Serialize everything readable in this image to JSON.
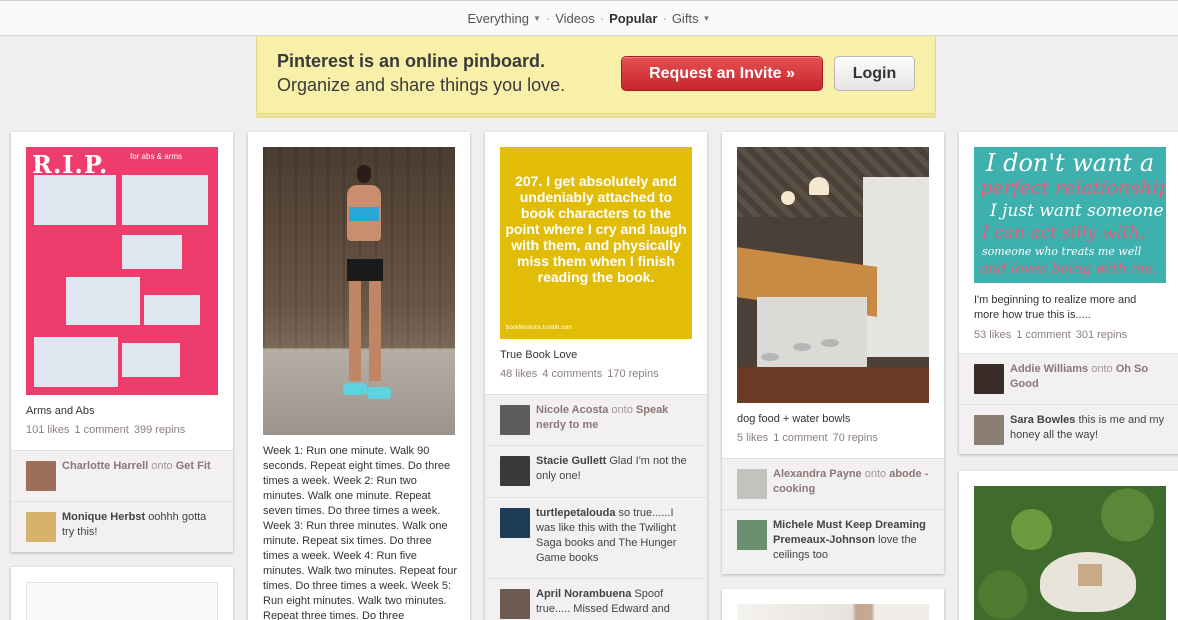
{
  "nav": {
    "everything": "Everything",
    "videos": "Videos",
    "popular": "Popular",
    "gifts": "Gifts",
    "separator": "·"
  },
  "banner": {
    "line1": "Pinterest is an online pinboard.",
    "line2": "Organize and share things you love.",
    "invite_label": "Request an Invite »",
    "login_label": "Login"
  },
  "pins": [
    {
      "title": "Arms and Abs",
      "likes": "101 likes",
      "comments": "1 comment",
      "repins": "399 repins",
      "image_header": "R.I.P.",
      "image_subtitle": "for abs & arms",
      "comment_list": [
        {
          "user": "Charlotte Harrell",
          "onto": "onto",
          "board": "Get Fit",
          "text": ""
        },
        {
          "user": "Monique Herbst",
          "onto": "",
          "board": "",
          "text": "oohhh gotta try this!"
        }
      ]
    },
    {
      "title": "Week 1: Run one minute. Walk 90 seconds. Repeat eight times. Do three times a week. Week 2: Run two minutes. Walk one minute. Repeat seven times. Do three times a week. Week 3: Run three minutes. Walk one minute. Repeat six times. Do three times a week. Week 4: Run five minutes. Walk two minutes. Repeat four times. Do three times a week. Week 5: Run eight minutes. Walk two minutes. Repeat three times. Do three"
    },
    {
      "image_text": "207. I get absolutely and undeniably attached to book characters to the point where I cry and laugh with them, and physically miss them when I finish reading the book.",
      "image_credit": "bookfessions.tumblr.com",
      "title": "True Book Love",
      "likes": "48 likes",
      "comments": "4 comments",
      "repins": "170 repins",
      "comment_list": [
        {
          "user": "Nicole Acosta",
          "onto": "onto",
          "board": "Speak nerdy to me",
          "text": ""
        },
        {
          "user": "Stacie Gullett",
          "onto": "",
          "board": "",
          "text": "Glad I'm not the only one!"
        },
        {
          "user": "turtlepetalouda",
          "onto": "",
          "board": "",
          "text": "so true......I was like this with the Twilight Saga books and The Hunger Game books"
        },
        {
          "user": "April Norambuena",
          "onto": "",
          "board": "",
          "text": "Spoof true..... Missed Edward and"
        }
      ]
    },
    {
      "title": "dog food + water bowls",
      "likes": "5 likes",
      "comments": "1 comment",
      "repins": "70 repins",
      "comment_list": [
        {
          "user": "Alexandra Payne",
          "onto": "onto",
          "board": "abode - cooking",
          "text": ""
        },
        {
          "user": "Michele Must Keep Dreaming Premeaux-Johnson",
          "onto": "",
          "board": "",
          "text": "love the ceilings too"
        }
      ]
    },
    {
      "image_lines": [
        "I don't want a",
        "perfect relationship",
        "I just want someone",
        "I can act silly with,",
        "someone who treats me well",
        "and loves being with me."
      ],
      "title": "I'm beginning to realize more and more how true this is.....",
      "likes": "53 likes",
      "comments": "1 comment",
      "repins": "301 repins",
      "comment_list": [
        {
          "user": "Addie Williams",
          "onto": "onto",
          "board": "Oh So Good",
          "text": ""
        },
        {
          "user": "Sara Bowles",
          "onto": "",
          "board": "",
          "text": "this is me and my honey all the way!"
        }
      ]
    }
  ],
  "colors": {
    "invite_red": "#d4343c",
    "banner_yellow": "#f8f0a8",
    "book_yellow": "#e2bd07",
    "quote_teal": "#3eb0ae",
    "quote_pink": "#ec5a7a"
  }
}
